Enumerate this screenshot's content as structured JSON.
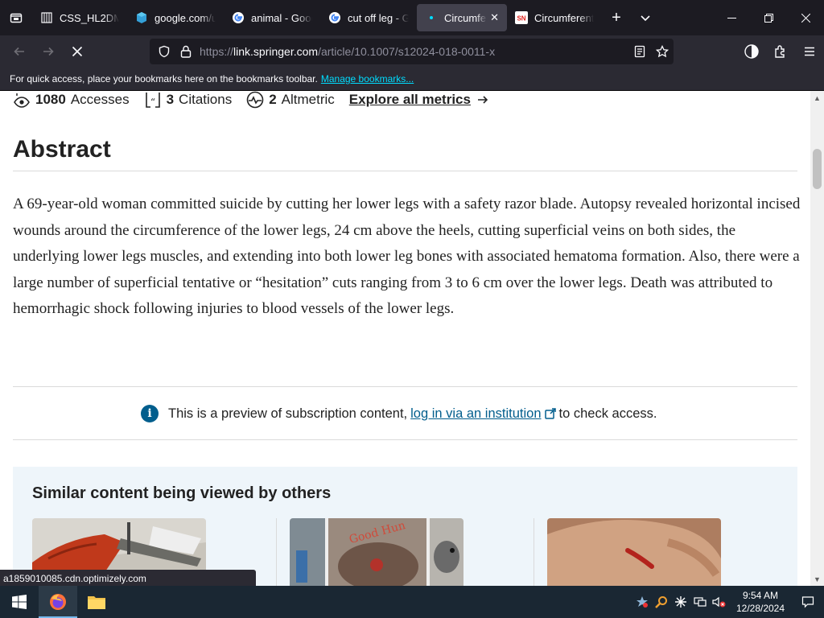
{
  "browser": {
    "tabs": [
      {
        "title": "CSS_HL2DM_I",
        "icon": "generic-page-icon",
        "active": false
      },
      {
        "title": "google.com/u",
        "icon": "google-icon",
        "active": false
      },
      {
        "title": "animal - Goog",
        "icon": "google-icon",
        "active": false
      },
      {
        "title": "cut off leg - G",
        "icon": "google-icon",
        "active": false
      },
      {
        "title": "Circumfere",
        "icon": "loading-dot-icon",
        "active": true
      },
      {
        "title": "Circumferenti",
        "icon": "springer-nature-icon",
        "active": false
      }
    ],
    "url_prefix": "https://",
    "url_host": "link.springer.com",
    "url_path": "/article/10.1007/s12024-018-0011-x",
    "bookmarks_text": "For quick access, place your bookmarks here on the bookmarks toolbar.",
    "bookmarks_link": "Manage bookmarks...",
    "status_text": "a1859010085.cdn.optimizely.com"
  },
  "article": {
    "metrics": [
      {
        "value": "1080",
        "label": "Accesses",
        "icon": "eye-icon"
      },
      {
        "value": "3",
        "label": "Citations",
        "icon": "quote-icon"
      },
      {
        "value": "2",
        "label": "Altmetric",
        "icon": "altmetric-icon"
      }
    ],
    "explore_link": "Explore all metrics",
    "abstract_heading": "Abstract",
    "abstract_text": "A 69-year-old woman committed suicide by cutting her lower legs with a safety razor blade. Autopsy revealed horizontal incised wounds around the circumference of the lower legs, 24 cm above the heels, cutting superficial veins on both sides, the underlying lower legs muscles, and extending into both lower leg bones with associated hematoma formation. Also, there were a large number of superficial tentative or “hesitation” cuts ranging from 3 to 6 cm over the lower legs. Death was attributed to hemorrhagic shock following injuries to blood vessels of the lower legs.",
    "preview_prefix": "This is a preview of subscription content,",
    "preview_link": "log in via an institution",
    "preview_suffix": "to check access.",
    "similar_heading": "Similar content being viewed by others"
  },
  "taskbar": {
    "time": "9:54 AM",
    "date": "12/28/2024"
  },
  "colors": {
    "link_blue": "#025e8d",
    "firefox_accent": "#00ddff"
  }
}
